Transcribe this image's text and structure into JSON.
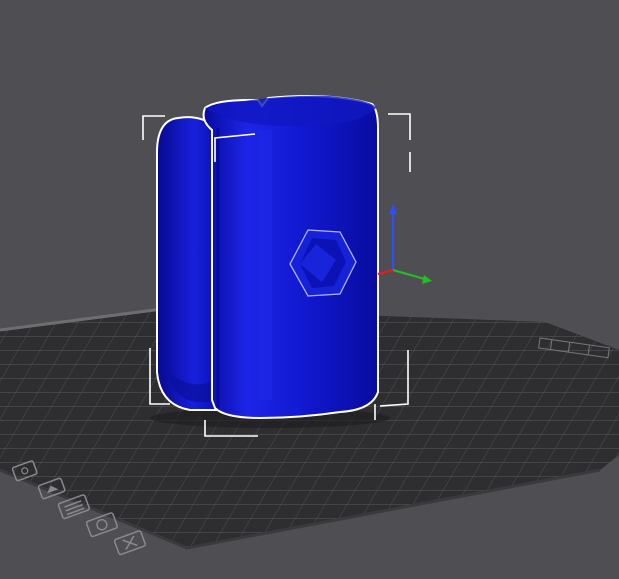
{
  "app": {
    "view": "3D preview"
  },
  "colors": {
    "background": "#4e4e53",
    "bed": "#2d2d30",
    "grid": "#5a5a5e",
    "model": "#0f16c8",
    "model_shade": "#070b9a",
    "model_highlight": "#2a34ee",
    "bounding_box": "#ffffff",
    "axis_x": "#e02020",
    "axis_y": "#22c022",
    "axis_z": "#2a50ff"
  },
  "icons": {
    "bed_markers": [
      "print-bed-icon",
      "home-icon",
      "layers-icon",
      "camera-icon",
      "close-x-icon"
    ]
  }
}
